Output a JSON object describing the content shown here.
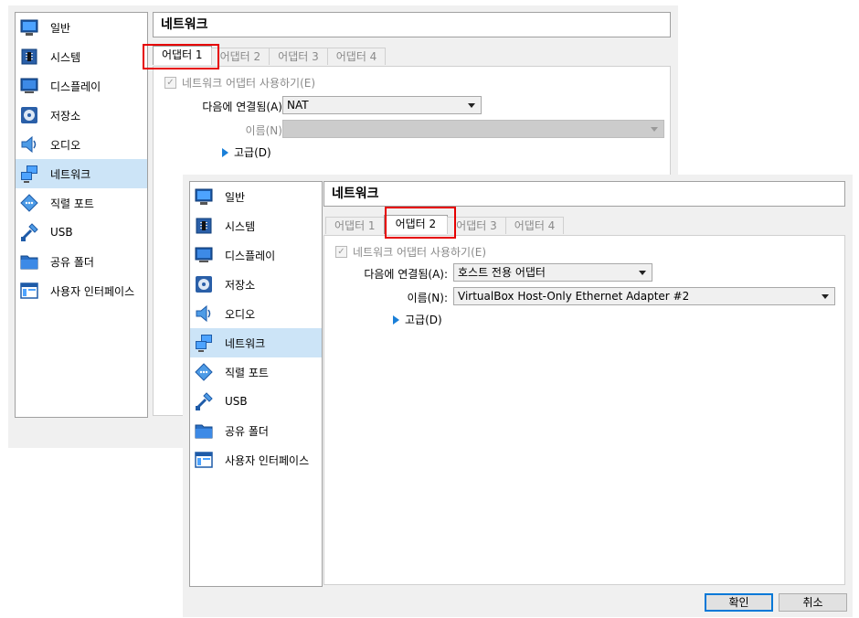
{
  "sidebar": {
    "items": [
      {
        "label": "일반",
        "icon": "general-icon"
      },
      {
        "label": "시스템",
        "icon": "system-chip-icon"
      },
      {
        "label": "디스플레이",
        "icon": "display-monitor-icon"
      },
      {
        "label": "저장소",
        "icon": "storage-disk-icon"
      },
      {
        "label": "오디오",
        "icon": "audio-speaker-icon"
      },
      {
        "label": "네트워크",
        "icon": "network-icon"
      },
      {
        "label": "직렬 포트",
        "icon": "serial-port-icon"
      },
      {
        "label": "USB",
        "icon": "usb-icon"
      },
      {
        "label": "공유 폴더",
        "icon": "shared-folder-icon"
      },
      {
        "label": "사용자 인터페이스",
        "icon": "user-interface-icon"
      }
    ],
    "selected": "네트워크"
  },
  "section_title": "네트워크",
  "tabs": [
    "어댑터 1",
    "어댑터 2",
    "어댑터 3",
    "어댑터 4"
  ],
  "labels": {
    "enable": "네트워크 어댑터 사용하기(E)",
    "attached_to": "다음에 연결됨(A):",
    "name": "이름(N):",
    "advanced": "고급(D)",
    "check_mark": "✓"
  },
  "adapter1": {
    "attached_value": "NAT",
    "name_value": ""
  },
  "adapter2": {
    "attached_value": "호스트 전용 어댑터",
    "name_value": "VirtualBox Host-Only Ethernet Adapter #2"
  },
  "buttons": {
    "ok": "확인",
    "cancel": "취소"
  },
  "colors": {
    "highlight": "#e60000",
    "selected_item": "#cce4f7",
    "default_button_border": "#0078d7"
  }
}
